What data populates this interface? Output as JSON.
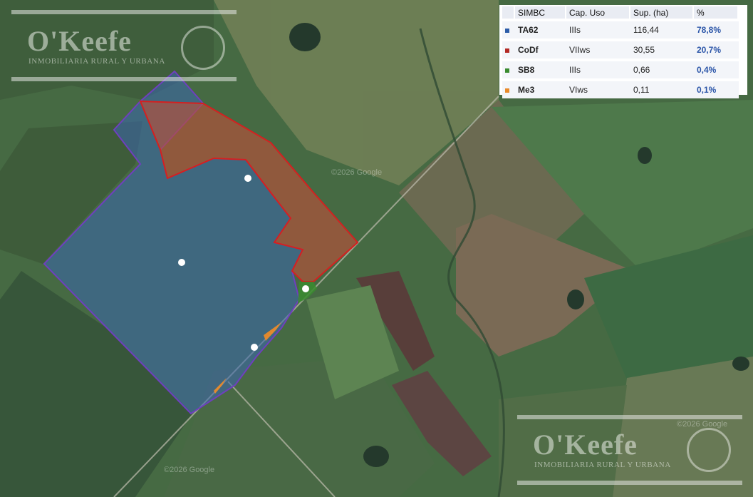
{
  "legend": {
    "headers": [
      "SIMBC",
      "Cap. Uso",
      "Sup. (ha)",
      "%"
    ],
    "rows": [
      {
        "code": "TA62",
        "cap": "IIIs",
        "sup": "116,44",
        "pct": "78,8%",
        "color": "#2c5ca8"
      },
      {
        "code": "CoDf",
        "cap": "VIIws",
        "sup": "30,55",
        "pct": "20,7%",
        "color": "#b42a25"
      },
      {
        "code": "SB8",
        "cap": "IIIs",
        "sup": "0,66",
        "pct": "0,4%",
        "color": "#3a8b2f"
      },
      {
        "code": "Me3",
        "cap": "VIws",
        "sup": "0,11",
        "pct": "0,1%",
        "color": "#e98a2a"
      }
    ]
  },
  "watermark": {
    "name": "O'Keefe",
    "tagline": "INMOBILIARIA RURAL Y URBANA"
  },
  "map_attribution": [
    "©2026 Google",
    "©2026 Google",
    "©2026 Google"
  ],
  "colors": {
    "ta62_fill": "#3b66b0",
    "codf_fill": "#b8503a",
    "sb8_fill": "#3a8b2f",
    "me3_fill": "#e98a2a",
    "parcel_outline": "#6f3fbf",
    "codf_outline": "#d42020"
  }
}
